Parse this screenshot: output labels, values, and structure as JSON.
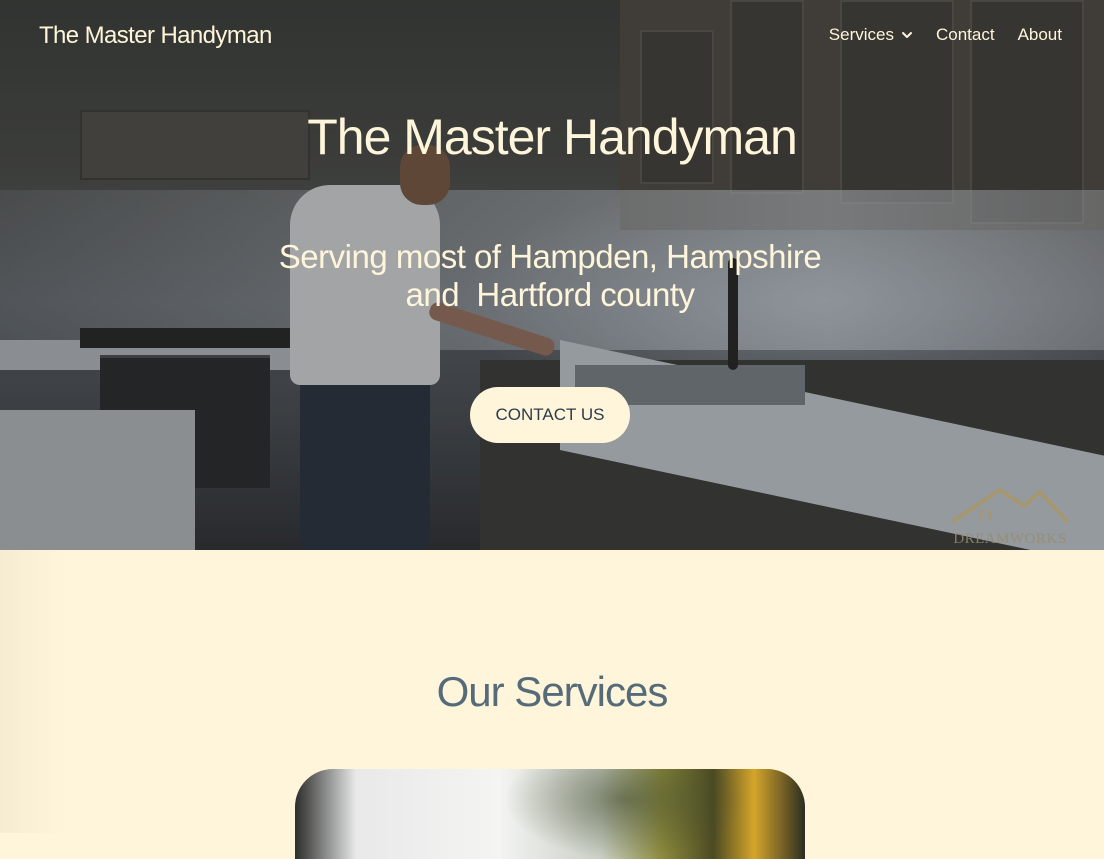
{
  "header": {
    "brand": "The Master Handyman",
    "nav": {
      "services": "Services",
      "contact": "Contact",
      "about": "About"
    }
  },
  "hero": {
    "title": "The Master Handyman",
    "subtitle_line1": "Serving most of Hampden, Hampshire",
    "subtitle_line2": "and  Hartford county",
    "cta_label": "CONTACT US",
    "watermark": "DREAMWORKS"
  },
  "services": {
    "title": "Our Services"
  },
  "colors": {
    "cream": "#fef5da",
    "slate": "#566b79",
    "button_text": "#2d3b4a"
  },
  "icons": {
    "services_dropdown": "chevron-down-icon",
    "watermark_logo": "house-roof-icon"
  }
}
